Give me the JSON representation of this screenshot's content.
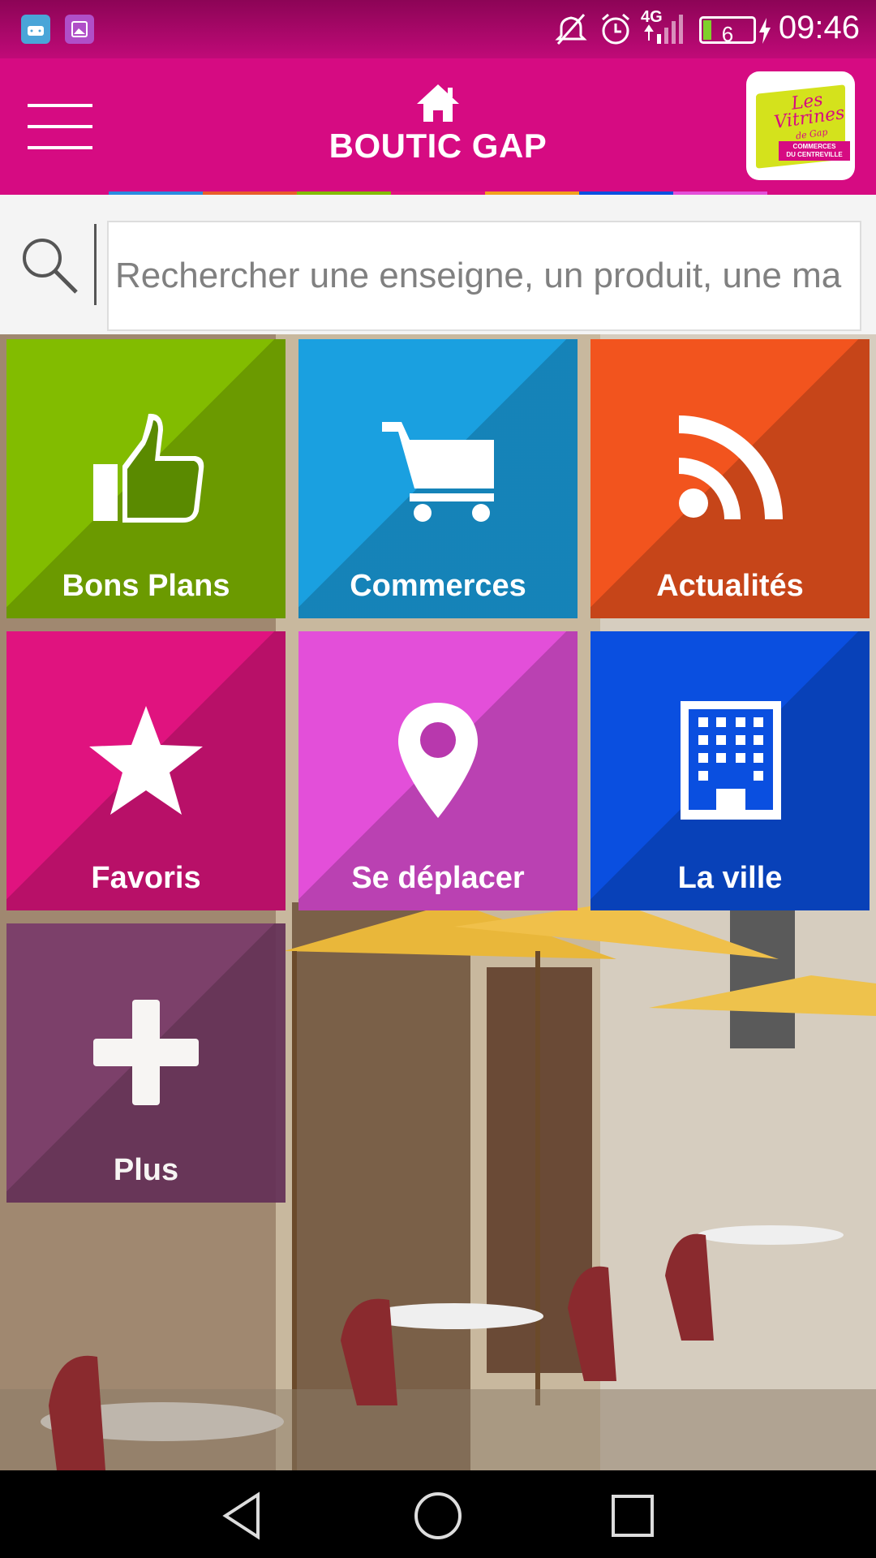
{
  "status_bar": {
    "network": "4G",
    "battery_level": "6",
    "time": "09:46"
  },
  "header": {
    "title": "BOUTIC GAP",
    "logo": {
      "script_line1": "Les",
      "script_line2": "Vitrines",
      "script_line3": "de Gap",
      "band_line1": "COMMERCES",
      "band_line2": "DU CENTREVILLE"
    }
  },
  "search": {
    "placeholder": "Rechercher une enseigne, un produit, une ma"
  },
  "tiles": [
    {
      "label": "Bons Plans",
      "icon": "thumbs-up-icon",
      "color": "#82bc00"
    },
    {
      "label": "Commerces",
      "icon": "shopping-cart-icon",
      "color": "#1aa0e0"
    },
    {
      "label": "Actualités",
      "icon": "rss-feed-icon",
      "color": "#f2541e"
    },
    {
      "label": "Favoris",
      "icon": "star-icon",
      "color": "#e0137f"
    },
    {
      "label": "Se déplacer",
      "icon": "map-pin-icon",
      "color": "#e34fd9"
    },
    {
      "label": "La ville",
      "icon": "building-icon",
      "color": "#0a4fe0"
    },
    {
      "label": "Plus",
      "icon": "plus-icon",
      "color": "#7a3a6a"
    }
  ],
  "colors": {
    "brand": "#d60b82",
    "strip": [
      "#2a8be0",
      "#e85d2a",
      "#82bc00",
      "#e0137f",
      "#e34fd9",
      "#f2a01e",
      "#0a4fe0"
    ]
  }
}
